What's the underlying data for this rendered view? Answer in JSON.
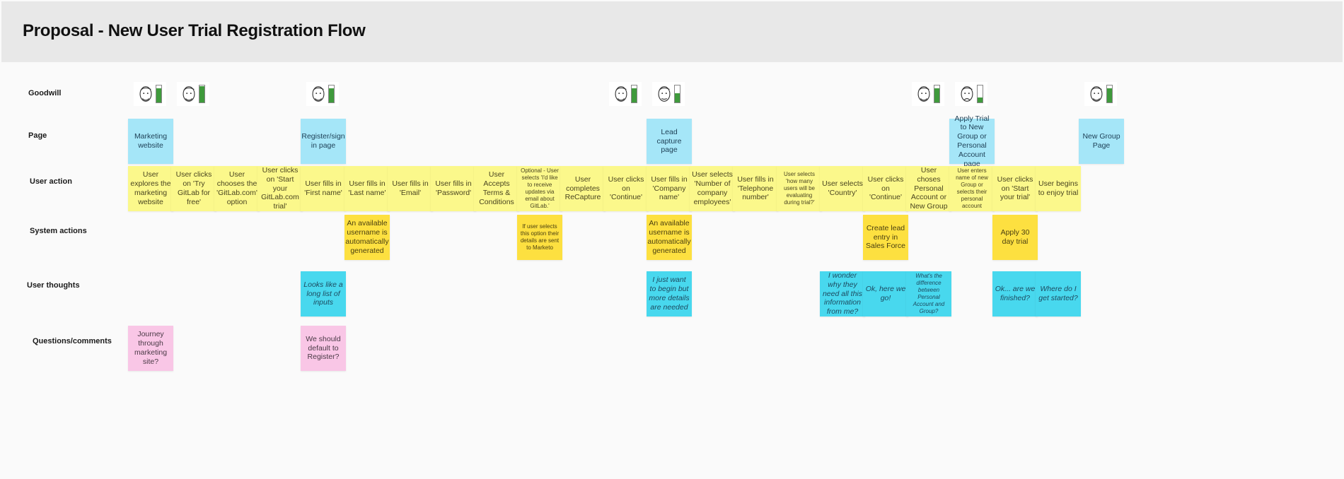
{
  "title": "Proposal - New User Trial Registration Flow",
  "rows": {
    "goodwill": "Goodwill",
    "page": "Page",
    "user_action": "User action",
    "system_actions": "System actions",
    "user_thoughts": "User thoughts",
    "questions": "Questions/comments"
  },
  "goodwill": [
    {
      "col": 0,
      "mood": "happy",
      "level": 0.85
    },
    {
      "col": 1,
      "mood": "happy",
      "level": 0.95
    },
    {
      "col": 4,
      "mood": "happy",
      "level": 0.85
    },
    {
      "col": 11,
      "mood": "happy",
      "level": 0.85
    },
    {
      "col": 12,
      "mood": "neutral",
      "level": 0.55
    },
    {
      "col": 18,
      "mood": "happy",
      "level": 0.85
    },
    {
      "col": 19,
      "mood": "sad",
      "level": 0.3
    },
    {
      "col": 22,
      "mood": "happy",
      "level": 0.85
    }
  ],
  "pages": [
    {
      "col": 0,
      "text": "Marketing website"
    },
    {
      "col": 4,
      "text": "Register/sign in page"
    },
    {
      "col": 12,
      "text": "Lead capture page"
    },
    {
      "col": 19,
      "text": "Apply Trial to New Group or Personal Account page"
    },
    {
      "col": 22,
      "text": "New Group Page"
    }
  ],
  "user_actions": [
    {
      "text": "User explores the marketing website"
    },
    {
      "text": "User clicks on 'Try GitLab for free'"
    },
    {
      "text": "User chooses the 'GitLab.com' option"
    },
    {
      "text": "User clicks on 'Start your GitLab.com trial'"
    },
    {
      "text": "User fills in 'First name'"
    },
    {
      "text": "User fills in 'Last name'"
    },
    {
      "text": "User fills in 'Email'"
    },
    {
      "text": "User fills in 'Password'"
    },
    {
      "text": "User Accepts Terms & Conditions"
    },
    {
      "text": "Optional - User selects 'I'd like to receive updates via email about GitLab.'",
      "small": true
    },
    {
      "text": "User completes ReCapture"
    },
    {
      "text": "User clicks on 'Continue'"
    },
    {
      "text": "User fills in 'Company name'"
    },
    {
      "text": "User selects 'Number of company employees'"
    },
    {
      "text": "User fills in 'Telephone number'"
    },
    {
      "text": "User selects 'how many users will be evaluating during trial?'",
      "small": true
    },
    {
      "text": "User selects 'Country'"
    },
    {
      "text": "User clicks on 'Continue'"
    },
    {
      "text": "User choses Personal Account or New Group"
    },
    {
      "text": "User enters name of new Group or selects their personal account",
      "small": true
    },
    {
      "text": "User clicks on 'Start your trial'"
    },
    {
      "text": "User begins to enjoy trial"
    }
  ],
  "system_actions": [
    {
      "col": 5,
      "text": "An available username is automatically generated"
    },
    {
      "col": 9,
      "text": "If user selects this option their details are sent to Marketo",
      "small": true
    },
    {
      "col": 12,
      "text": "An available username is automatically generated"
    },
    {
      "col": 17,
      "text": "Create lead entry in Sales Force"
    },
    {
      "col": 20,
      "text": "Apply 30 day trial"
    }
  ],
  "user_thoughts": [
    {
      "col": 4,
      "text": "Looks like a long list of inputs"
    },
    {
      "col": 12,
      "text": "I just want to begin but more details are needed"
    },
    {
      "col": 16,
      "text": "I wonder why they need all this information from me?"
    },
    {
      "col": 17,
      "text": "Ok, here we go!"
    },
    {
      "col": 18,
      "text": "What's the difference between Personal Account and Group?",
      "small": true
    },
    {
      "col": 20,
      "text": "Ok... are we finished?"
    },
    {
      "col": 21,
      "text": "Where do I get started?"
    }
  ],
  "questions": [
    {
      "col": 0,
      "text": "Journey through marketing site?"
    },
    {
      "col": 4,
      "text": "We should default to Register?"
    }
  ]
}
